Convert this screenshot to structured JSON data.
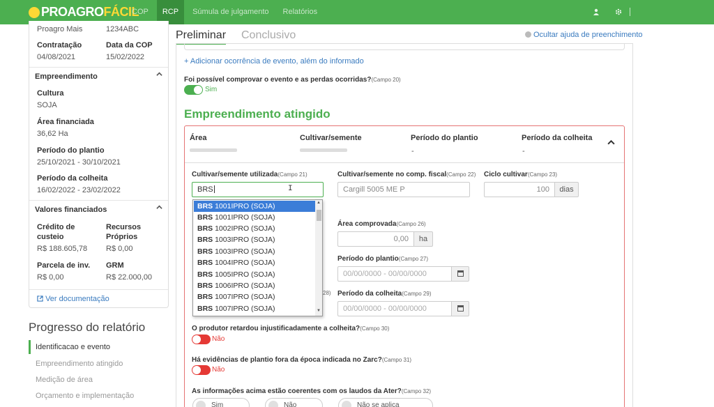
{
  "topbar": {
    "logo_prefix": "PROAGRO",
    "logo_accent": "FÁCIL",
    "nav": [
      "COP",
      "RCP",
      "Súmula de julgamento",
      "Relatórios"
    ],
    "active_nav": "RCP",
    "icons": [
      "user-icon",
      "gear-icon"
    ],
    "colors": {
      "bar": "#4caf50",
      "active": "#388e3c",
      "logo_accent": "#fdd835"
    }
  },
  "sidebar": {
    "program": "Proagro Mais",
    "code": "1234ABC",
    "contratacao_label": "Contratação",
    "contratacao_value": "04/08/2021",
    "data_cop_label": "Data da COP",
    "data_cop_value": "15/02/2022",
    "empreendimento_title": "Empreendimento",
    "cultura_label": "Cultura",
    "cultura_value": "SOJA",
    "area_label": "Área financiada",
    "area_value": "36,62 Ha",
    "plantio_label": "Período do plantio",
    "plantio_value": "25/10/2021 - 30/10/2021",
    "colheita_label": "Período da colheita",
    "colheita_value": "16/02/2022 - 23/02/2022",
    "valores_title": "Valores financiados",
    "credito_label_1": "Crédito de",
    "credito_label_2": "custeio",
    "credito_value": "R$ 188.605,78",
    "recursos_label_1": "Recursos",
    "recursos_label_2": "Próprios",
    "recursos_value": "R$ 0,00",
    "parcela_label": "Parcela de inv.",
    "parcela_value": "R$ 0,00",
    "grm_label": "GRM",
    "grm_value": "R$ 22.000,00",
    "doc_link": "Ver documentação"
  },
  "progress": {
    "title": "Progresso do relatório",
    "items": [
      "Identificacao e evento",
      "Empreendimento atingido",
      "Medição de área",
      "Orçamento e implementação"
    ],
    "active_index": 0
  },
  "tabs": [
    "Preliminar",
    "Conclusivo"
  ],
  "active_tab": "Preliminar",
  "help_link": "Ocultar ajuda de preenchimento",
  "add_occurrence": "+ Adicionar ocorrência de evento, além do informado",
  "q_evento": {
    "label": "Foi possível comprovar o evento e as perdas ocorridas?",
    "campo": "(Campo 20)",
    "value": "Sim"
  },
  "section_title": "Empreendimento atingido",
  "table_header": {
    "cols": [
      "Área",
      "Cultivar/semente",
      "Período do plantio",
      "Período da colheita"
    ],
    "dash_plantio": "-",
    "dash_colheita": "-"
  },
  "fields": {
    "cultivar_label": "Cultivar/semente utilizada",
    "cultivar_campo": "(Campo 21)",
    "cultivar_value": "BRS",
    "fiscal_label": "Cultivar/semente no comp. fiscal",
    "fiscal_campo": "(Campo 22)",
    "fiscal_value": "Cargill 5005 ME P",
    "ciclo_label": "Ciclo cultivar",
    "ciclo_campo": "(Campo 23)",
    "ciclo_value": "100",
    "ciclo_unit": "dias",
    "area_comp_label": "Área comprovada",
    "area_comp_campo": "(Campo 26)",
    "area_comp_value": "0,00",
    "area_comp_unit": "ha",
    "plantio_label": "Período do plantio",
    "plantio_campo": "(Campo 27)",
    "plantio_placeholder": "00/00/0000 - 00/00/0000",
    "colheita_label": "Período da colheita",
    "colheita_campo": "(Campo 29)",
    "colheita_placeholder": "00/00/0000 - 00/00/0000",
    "hidden_campo_fragment": "28)"
  },
  "dropdown": {
    "items": [
      {
        "bold": "BRS",
        "rest": " 1001IPRO (SOJA)"
      },
      {
        "bold": "BRS",
        "rest": " 1001IPRO (SOJA)"
      },
      {
        "bold": "BRS",
        "rest": " 1002IPRO (SOJA)"
      },
      {
        "bold": "BRS",
        "rest": " 1003IPRO (SOJA)"
      },
      {
        "bold": "BRS",
        "rest": " 1003IPRO (SOJA)"
      },
      {
        "bold": "BRS",
        "rest": " 1004IPRO (SOJA)"
      },
      {
        "bold": "BRS",
        "rest": " 1005IPRO (SOJA)"
      },
      {
        "bold": "BRS",
        "rest": " 1006IPRO (SOJA)"
      },
      {
        "bold": "BRS",
        "rest": " 1007IPRO (SOJA)"
      },
      {
        "bold": "BRS",
        "rest": " 1007IPRO (SOJA)"
      }
    ],
    "selected_index": 0
  },
  "q_retardou": {
    "label": "O produtor retardou injustificadamente a colheita?",
    "campo": "(Campo 30)",
    "value": "Não"
  },
  "q_zarc": {
    "label": "Há evidências de plantio fora da época indicada no Zarc?",
    "campo": "(Campo 31)",
    "value": "Não"
  },
  "q_ater": {
    "label": "As informações acima estão coerentes com os laudos da Ater?",
    "campo": "(Campo 32)",
    "options": [
      "Sim",
      "Não",
      "Não se aplica"
    ]
  }
}
